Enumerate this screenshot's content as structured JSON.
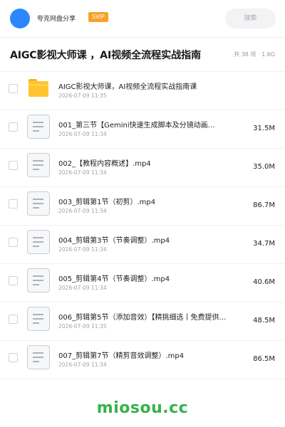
{
  "header": {
    "share_name": "夸克网盘分享",
    "badge": "SVIP",
    "search_placeholder": "搜索"
  },
  "page": {
    "title": "AIGC影视大师课 ，AI视频全流程实战指南",
    "meta": "共 38 项 · 1.6G"
  },
  "files": [
    {
      "type": "folder",
      "name": "AIGC影视大师课，AI视频全流程实战指南课",
      "date": "2026-07-09 11:35",
      "size": ""
    },
    {
      "type": "file",
      "name": "001_第三节【Gemini快速生成脚本及分镜动画…",
      "date": "2026-07-09 11:34",
      "size": "31.5M"
    },
    {
      "type": "file",
      "name": "002_【教程内容概述】.mp4",
      "date": "2026-07-09 11:34",
      "size": "35.0M"
    },
    {
      "type": "file",
      "name": "003_剪辑第1节（初剪）.mp4",
      "date": "2026-07-09 11:34",
      "size": "86.7M"
    },
    {
      "type": "file",
      "name": "004_剪辑第3节（节奏调整）.mp4",
      "date": "2026-07-09 11:34",
      "size": "34.7M"
    },
    {
      "type": "file",
      "name": "005_剪辑第4节（节奏调整）.mp4",
      "date": "2026-07-09 11:34",
      "size": "40.6M"
    },
    {
      "type": "file",
      "name": "006_剪辑第5节（添加音效）【精挑细选丨免费提供…",
      "date": "2026-07-09 11:35",
      "size": "48.5M"
    },
    {
      "type": "file",
      "name": "007_剪辑第7节（精剪音效调整）.mp4",
      "date": "2026-07-09 11:34",
      "size": "86.5M"
    }
  ],
  "watermark": "miosou.cc",
  "colors": {
    "avatar": "#2e86ff",
    "svip_badge": "#f7a12c",
    "folder": "#ffc52e",
    "watermark": "#35b24a"
  }
}
